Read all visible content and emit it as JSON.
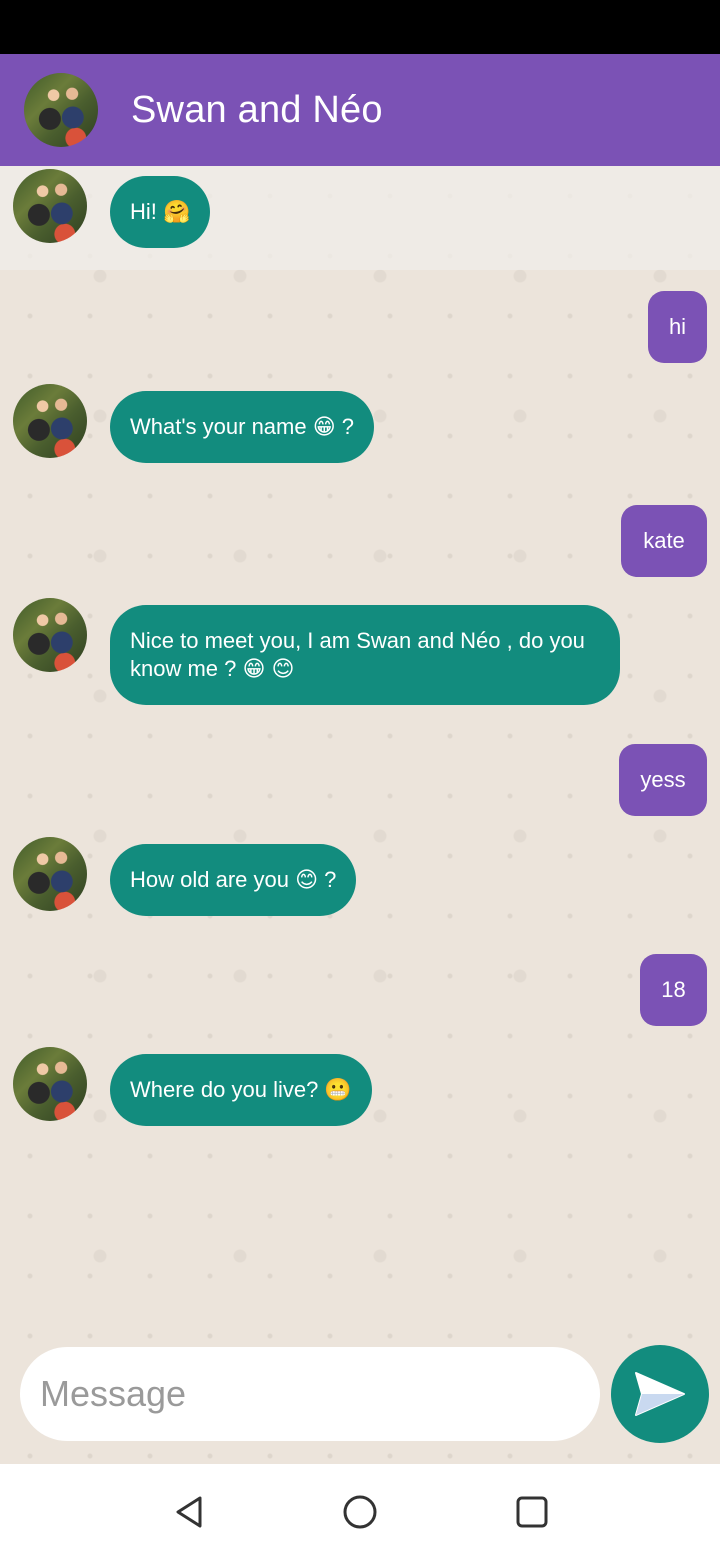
{
  "header": {
    "title": "Swan and Néo"
  },
  "messages": [
    {
      "from": "contact",
      "text": "Hi! 🤗"
    },
    {
      "from": "me",
      "text": "hi"
    },
    {
      "from": "contact",
      "text": "What's your name 😁 ?"
    },
    {
      "from": "me",
      "text": "kate"
    },
    {
      "from": "contact",
      "text": "Nice to meet you, I am Swan and Néo , do you know me  ? 😁 😊"
    },
    {
      "from": "me",
      "text": "yess"
    },
    {
      "from": "contact",
      "text": "How old are you 😊 ?"
    },
    {
      "from": "me",
      "text": "18"
    },
    {
      "from": "contact",
      "text": "Where do you live? 😬"
    }
  ],
  "composer": {
    "placeholder": "Message",
    "value": ""
  },
  "colors": {
    "app_bar": "#7b52b5",
    "incoming_bubble": "#128c7e",
    "outgoing_bubble": "#7b52b5",
    "send_button": "#128c7e",
    "chat_background": "#ece4db"
  },
  "icons": {
    "send": "send-icon",
    "back": "back-icon",
    "home": "home-icon",
    "recents": "recents-icon"
  }
}
